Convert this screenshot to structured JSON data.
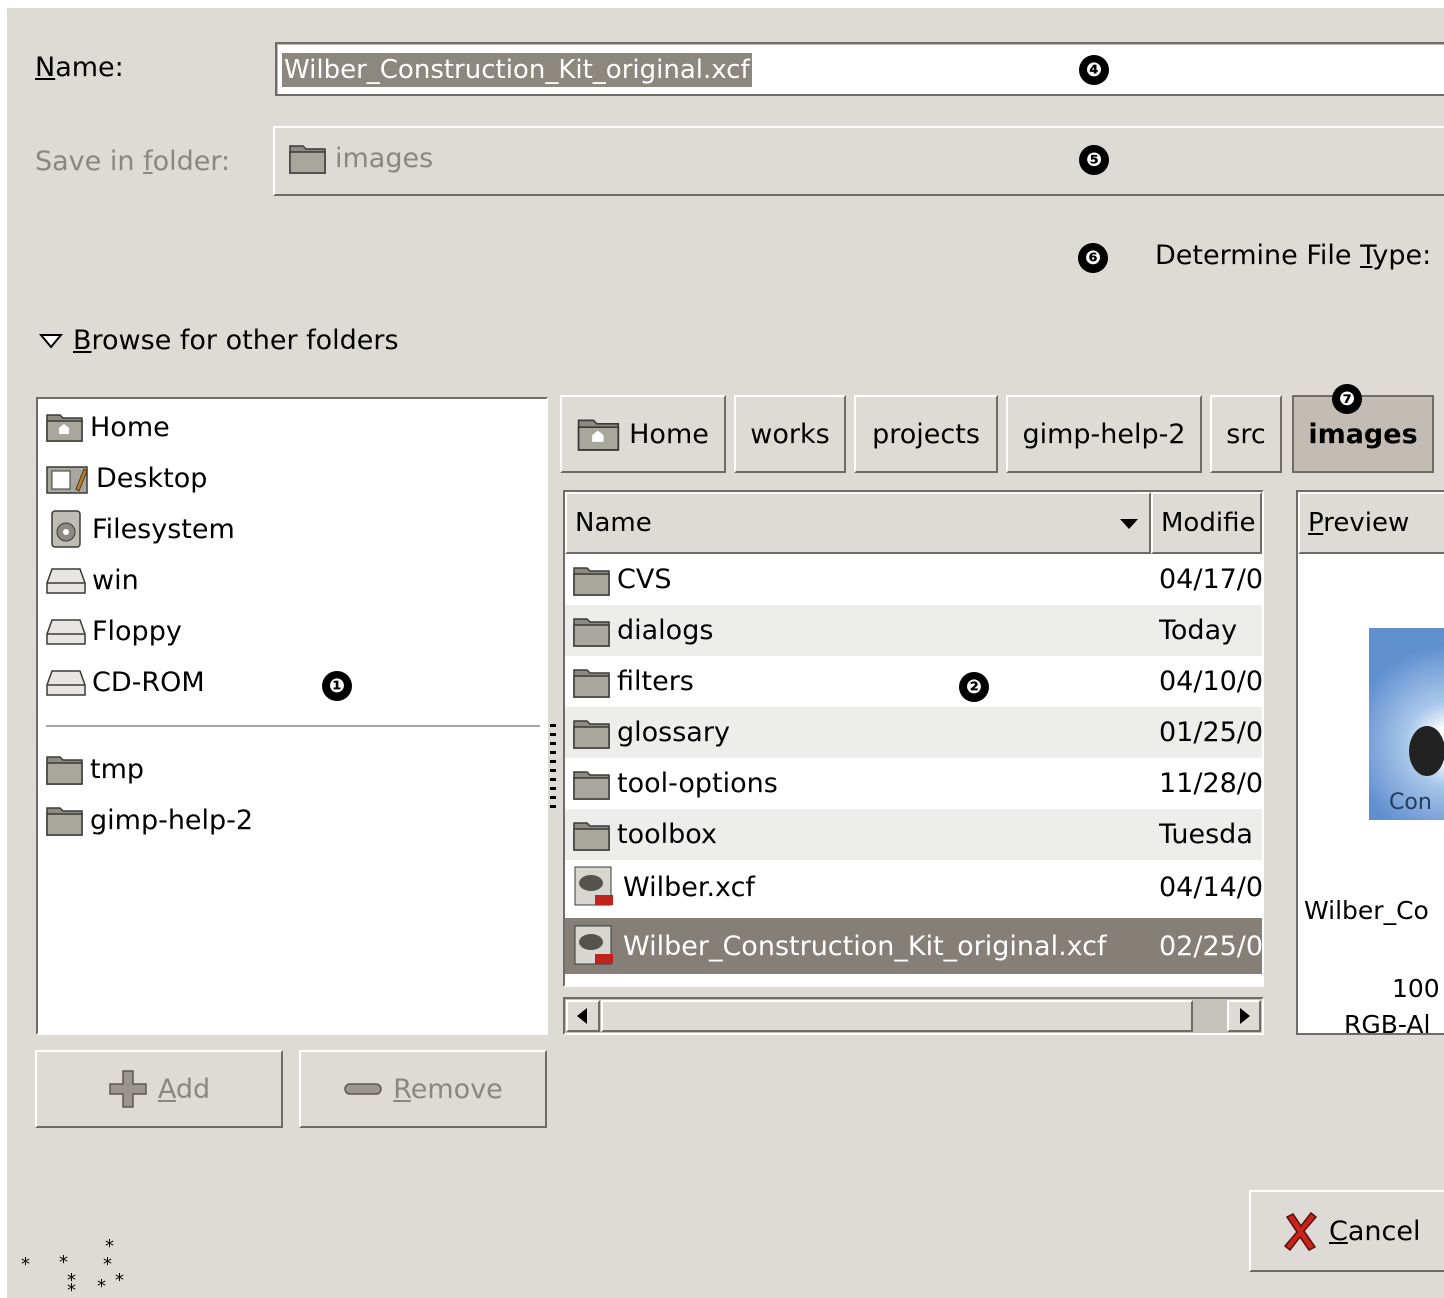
{
  "name_field": {
    "label": "Name:",
    "mnemonic": "N",
    "label_rest": "ame:",
    "value": "Wilber_Construction_Kit_original.xcf"
  },
  "save_in": {
    "label_pre": "Save in ",
    "mnemonic": "f",
    "label_post": "older:",
    "folder": "images"
  },
  "file_type": {
    "label_pre": "Determine File ",
    "mnemonic": "T",
    "label_post": "ype:"
  },
  "browse": {
    "mnemonic": "B",
    "label_rest": "rowse for other folders"
  },
  "badges": {
    "b1": "❶",
    "b2": "❷",
    "b4": "❹",
    "b5": "❺",
    "b6": "❻",
    "b7": "❼"
  },
  "places": [
    {
      "label": "Home",
      "icon": "home-icon"
    },
    {
      "label": "Desktop",
      "icon": "desktop-icon"
    },
    {
      "label": "Filesystem",
      "icon": "filesystem-icon"
    },
    {
      "label": "win",
      "icon": "drive-icon"
    },
    {
      "label": "Floppy",
      "icon": "drive-icon"
    },
    {
      "label": "CD-ROM",
      "icon": "drive-icon"
    }
  ],
  "bookmarks": [
    {
      "label": "tmp",
      "icon": "folder-icon"
    },
    {
      "label": "gimp-help-2",
      "icon": "folder-icon"
    }
  ],
  "buttons": {
    "add_m": "A",
    "add_rest": "dd",
    "remove_m": "R",
    "remove_rest": "emove",
    "cancel_m": "C",
    "cancel_rest": "ancel"
  },
  "path": [
    "Home",
    "works",
    "projects",
    "gimp-help-2",
    "src",
    "images"
  ],
  "columns": {
    "name": "Name",
    "modified": "Modifie",
    "preview_m": "P",
    "preview_rest": "review"
  },
  "files": [
    {
      "name": "CVS",
      "date": "04/17/0",
      "type": "folder"
    },
    {
      "name": "dialogs",
      "date": "Today",
      "type": "folder"
    },
    {
      "name": "filters",
      "date": "04/10/0",
      "type": "folder"
    },
    {
      "name": "glossary",
      "date": "01/25/0",
      "type": "folder"
    },
    {
      "name": "tool-options",
      "date": "11/28/0",
      "type": "folder"
    },
    {
      "name": "toolbox",
      "date": "Tuesda",
      "type": "folder"
    },
    {
      "name": "Wilber.xcf",
      "date": "04/14/0",
      "type": "xcf"
    },
    {
      "name": "Wilber_Construction_Kit_original.xcf",
      "date": "02/25/0",
      "type": "xcf",
      "selected": true
    }
  ],
  "preview": {
    "thumb_text": "Con",
    "filename": "Wilber_Co",
    "size": "100",
    "mode": "RGB-Al"
  },
  "colors": {
    "dialog_bg": "#dedad5",
    "selection": "#867f78",
    "border": "#6f6c67"
  }
}
